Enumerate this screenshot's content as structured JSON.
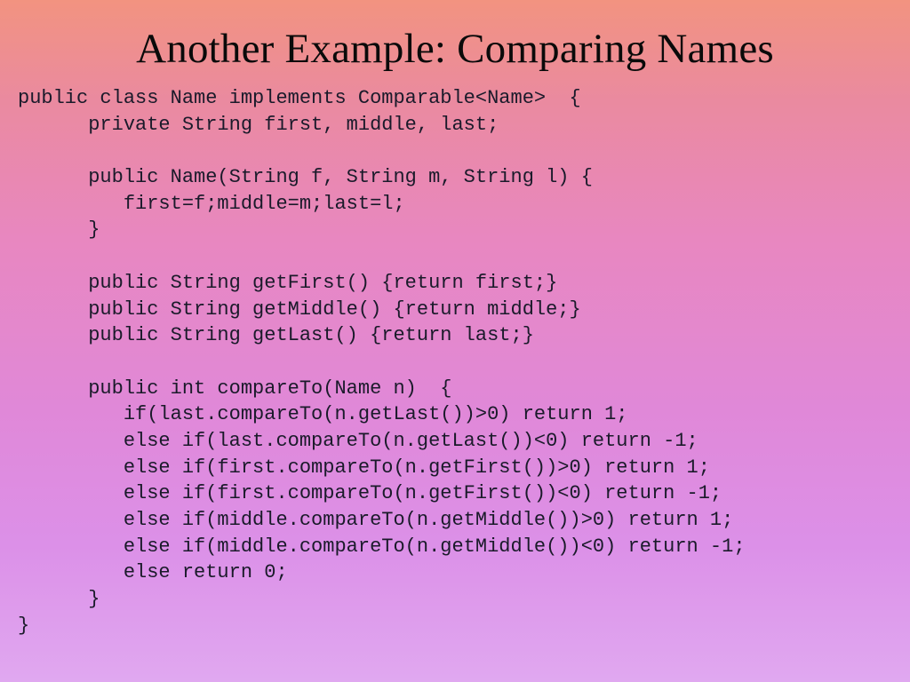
{
  "title": "Another Example:  Comparing Names",
  "code": "public class Name implements Comparable<Name>  {\n      private String first, middle, last;\n\n      public Name(String f, String m, String l) {\n         first=f;middle=m;last=l;\n      }\n\n      public String getFirst() {return first;}\n      public String getMiddle() {return middle;}\n      public String getLast() {return last;}\n\n      public int compareTo(Name n)  {\n         if(last.compareTo(n.getLast())>0) return 1;\n         else if(last.compareTo(n.getLast())<0) return -1;\n         else if(first.compareTo(n.getFirst())>0) return 1;\n         else if(first.compareTo(n.getFirst())<0) return -1;\n         else if(middle.compareTo(n.getMiddle())>0) return 1;\n         else if(middle.compareTo(n.getMiddle())<0) return -1;\n         else return 0;\n      }\n}"
}
